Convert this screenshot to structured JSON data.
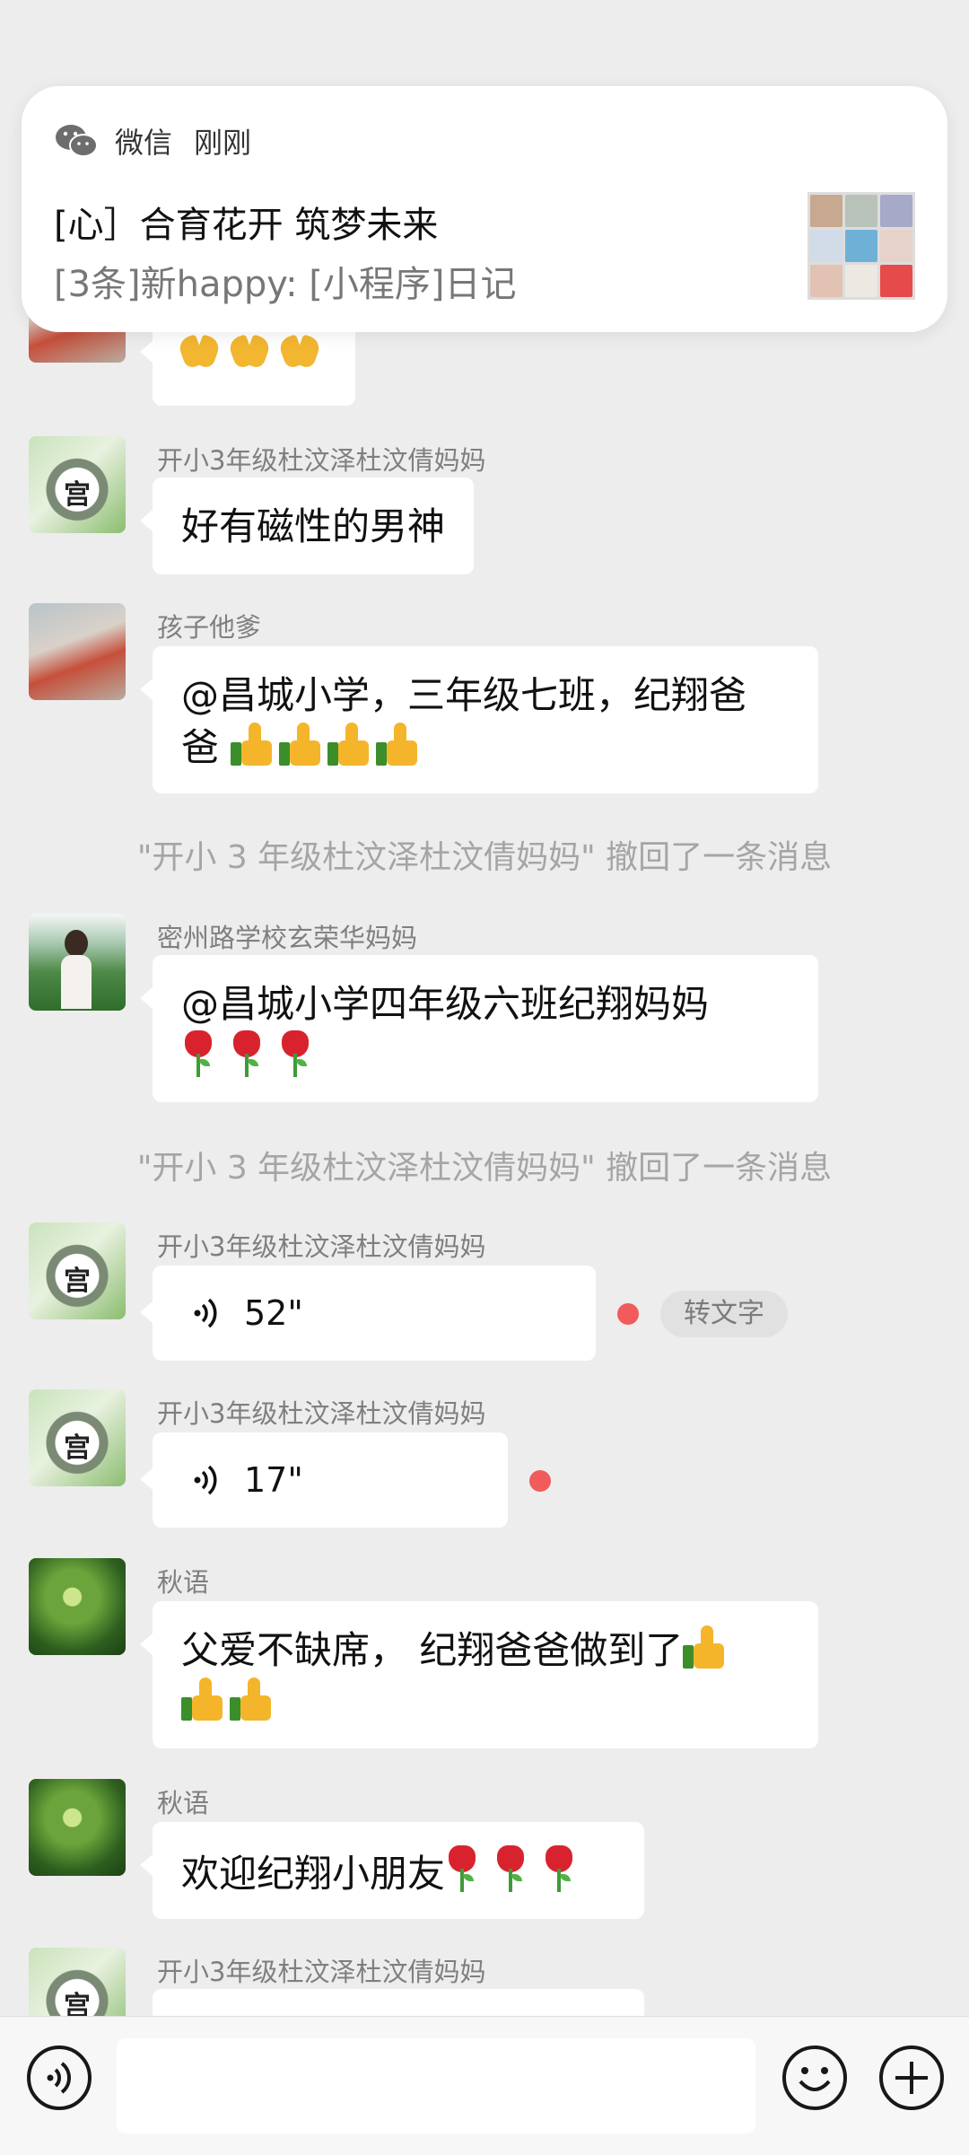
{
  "notification": {
    "app_name": "微信",
    "time": "刚刚",
    "title": "[心］合育花开 筑梦未来",
    "text": "[3条]新happy: [小程序]日记"
  },
  "messages": [
    {
      "id": "m0",
      "name": "",
      "text": ""
    },
    {
      "id": "m1",
      "name": "开小3年级杜汶泽杜汶倩妈妈",
      "text": "好有磁性的男神"
    },
    {
      "id": "m2",
      "name": "孩子他爹",
      "text_line1": "@昌城小学，三年级七班，纪翔爸",
      "text_line2": "爸"
    },
    {
      "id": "r1",
      "recall": "\"开小 3 年级杜汶泽杜汶倩妈妈\" 撤回了一条消息"
    },
    {
      "id": "m3",
      "name": "密州路学校玄荣华妈妈",
      "text": "@昌城小学四年级六班纪翔妈妈"
    },
    {
      "id": "r2",
      "recall": "\"开小 3 年级杜汶泽杜汶倩妈妈\" 撤回了一条消息"
    },
    {
      "id": "m4",
      "name": "开小3年级杜汶泽杜汶倩妈妈",
      "voice": "52\"",
      "to_text": "转文字"
    },
    {
      "id": "m5",
      "name": "开小3年级杜汶泽杜汶倩妈妈",
      "voice": "17\""
    },
    {
      "id": "m6",
      "name": "秋语",
      "text": "父爱不缺席， 纪翔爸爸做到了"
    },
    {
      "id": "m7",
      "name": "秋语",
      "text": "欢迎纪翔小朋友"
    },
    {
      "id": "m8",
      "name": "开小3年级杜汶泽杜汶倩妈妈"
    }
  ],
  "avatar_glyph": "宫",
  "icons": {
    "voice_toggle": "voice-icon",
    "emoji": "emoji-icon",
    "more": "plus-icon",
    "app": "wechat-icon"
  },
  "colors": {
    "background": "#ededed",
    "bubble": "#ffffff",
    "unread_dot": "#f15b5b"
  }
}
